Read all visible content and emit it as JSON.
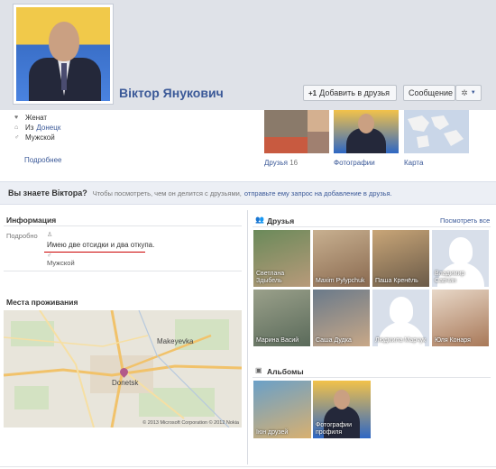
{
  "profile": {
    "name": "Віктор Янукович",
    "relationship": "Женат",
    "from_prefix": "Из",
    "from_city": "Донецк",
    "gender": "Мужской",
    "more_link": "Подробнее"
  },
  "actions": {
    "add_friend": "Добавить в друзья",
    "message": "Сообщение"
  },
  "thumbnails": {
    "friends_label": "Друзья",
    "friends_count": "16",
    "photos_label": "Фотографии",
    "map_label": "Карта"
  },
  "know_bar": {
    "title": "Вы знаете Віктора?",
    "text": "Чтобы посмотреть, чем он делится с друзьями,",
    "link": "отправьте ему запрос на добавление в друзья."
  },
  "info": {
    "title": "Информация",
    "label": "Подробно",
    "about": "Имею две отсидки и два откупа.",
    "gender": "Мужской"
  },
  "residence": {
    "title": "Места проживания",
    "city_main": "Donetsk",
    "city_other": "Makeyevka",
    "copyright": "© 2013 Microsoft Corporation © 2012 Nokia"
  },
  "friends": {
    "title": "Друзья",
    "see_all": "Посмотреть все",
    "items": [
      {
        "name": "Светлана Здыбель"
      },
      {
        "name": "Maxim Pylypchuk"
      },
      {
        "name": "Паша Кренёль"
      },
      {
        "name": "Владимир Савчин"
      },
      {
        "name": "Марина Васий"
      },
      {
        "name": "Саша Дудка"
      },
      {
        "name": "Людмила Марчук"
      },
      {
        "name": "Юля Конаря"
      }
    ]
  },
  "albums": {
    "title": "Альбомы",
    "items": [
      {
        "name": "Іюн друзей"
      },
      {
        "name": "Фотографии профиля"
      }
    ]
  },
  "colors": {
    "link": "#3b5998",
    "cover": "#dfe2e8",
    "bar": "#eceff5",
    "underline": "#cc0000"
  }
}
